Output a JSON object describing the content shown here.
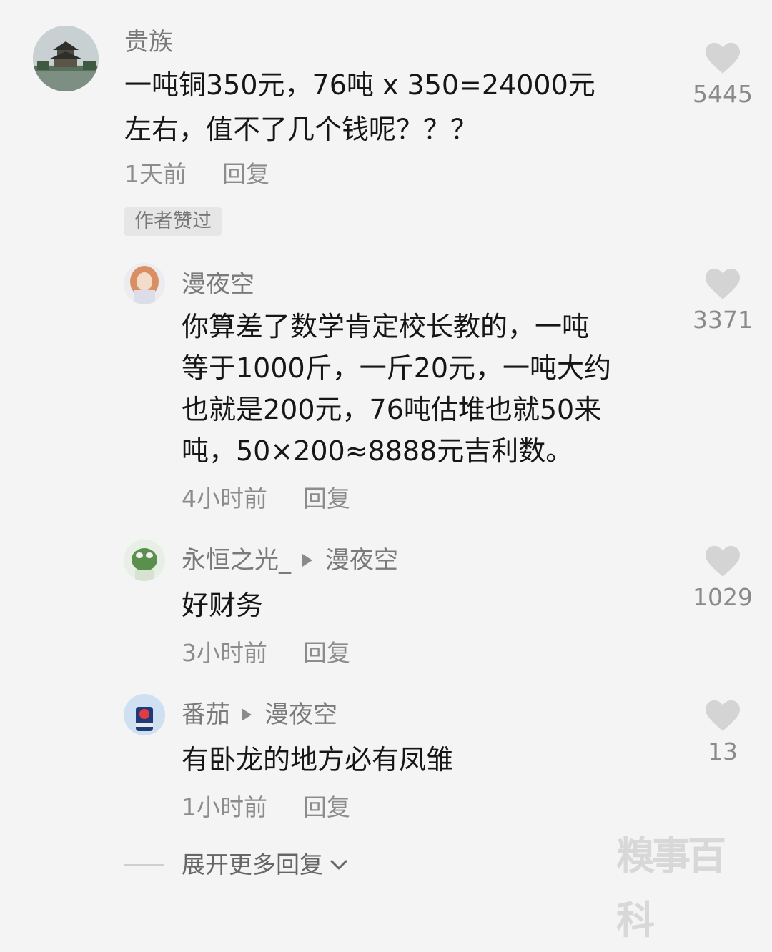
{
  "comments": [
    {
      "username": "贵族",
      "text_lines": [
        "一吨铜350元，76吨 x 350=24000元",
        "左右，值不了几个钱呢？？？"
      ],
      "time": "1天前",
      "reply_label": "回复",
      "likes": "5445",
      "badge": "作者赞过"
    }
  ],
  "replies": [
    {
      "username": "漫夜空",
      "text_lines": [
        "你算差了数学肯定校长教的，一吨",
        "等于1000斤，一斤20元，一吨大约",
        "也就是200元，76吨估堆也就50来",
        "吨，50×200≈8888元吉利数。"
      ],
      "time": "4小时前",
      "reply_label": "回复",
      "likes": "3371"
    },
    {
      "username": "永恒之光_",
      "reply_to": "漫夜空",
      "text_lines": [
        "好财务"
      ],
      "time": "3小时前",
      "reply_label": "回复",
      "likes": "1029"
    },
    {
      "username": "番茄",
      "reply_to": "漫夜空",
      "text_lines": [
        "有卧龙的地方必有凤雏"
      ],
      "time": "1小时前",
      "reply_label": "回复",
      "likes": "13"
    }
  ],
  "expand_label": "展开更多回复",
  "watermark": "糗事百科",
  "icons": {
    "like": "heart-icon",
    "expand": "chevron-down-icon"
  },
  "colors": {
    "background": "#f4f4f4",
    "heart": "#d4d4d4",
    "secondary_text": "#8c8c8c"
  }
}
